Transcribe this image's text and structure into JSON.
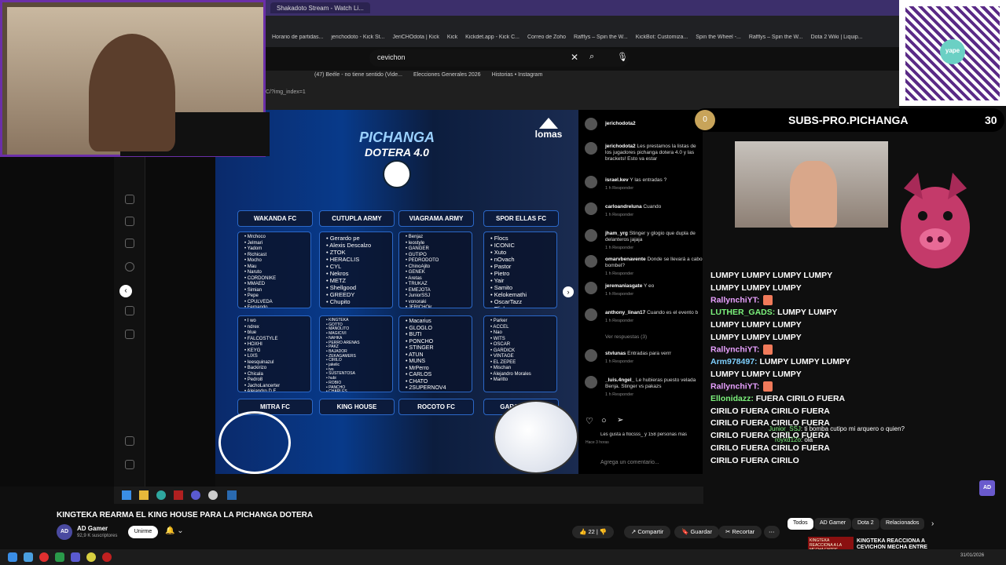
{
  "browser": {
    "tabs": [
      "Shakadoto Stream - Watch Li..."
    ],
    "bookmarks": [
      "Horario de partidas...",
      "jerichodoto - Kick St...",
      "JeriCHOdota | Kick",
      "Kick",
      "Kickdet.app - Kick C...",
      "Correo de Zoho",
      "Rafflys – Spin the W...",
      "KickBot: Customiza...",
      "Spin the Wheel -...",
      "Rafflys – Spin the W...",
      "Dota 2 Wiki | Liquip..."
    ],
    "search_value": "cevichon"
  },
  "inner_browser": {
    "tabs": [
      "(47) Beéle - no tiene sentido (Vide...",
      "Elecciones Generales 2026",
      "Historias • Instagram"
    ],
    "address": "C/?img_index=1"
  },
  "graphic": {
    "title1": "PICHANGA",
    "title2": "DOTERA",
    "version": "4.0",
    "sponsor": "lomas",
    "teams": [
      "WAKANDA FC",
      "CUTUPLA ARMY",
      "VIAGRAMA ARMY",
      "SPOR ELLAS FC",
      "MITRA FC",
      "KING HOUSE",
      "ROCOTO FC",
      "GARGOLA FC"
    ],
    "rosters": [
      [
        "Mrchoco",
        "Jelmari",
        "Yadom",
        "Richicast",
        "Mocho",
        "Mau",
        "Naruto",
        "CORDONIKE",
        "MMAED",
        "Simian",
        "Pepe",
        "CPULVEDA",
        "Fernando"
      ],
      [
        "Gerardo pe",
        "Alexis Descalzo",
        "ZTOK",
        "HERACLIS",
        "CYL",
        "Nekros",
        "METZ",
        "Shellgood",
        "GREEDY",
        "Chupito"
      ],
      [
        "Benjaz",
        "leostyle",
        "GANGER",
        "GUTIPO",
        "PEDRODOTO",
        "ChinoAjito",
        "GENEK",
        "Aretas",
        "TRUKAZ",
        "EMEJOTA",
        "JuniorSSJ",
        "vonoraki",
        "JERICHOjr"
      ],
      [
        "Flocs",
        "ICONIC",
        "Xuto",
        "nOvach",
        "Pastor",
        "Pietro",
        "Yair",
        "Samito",
        "Kelokemathi",
        "OscarTazz",
        "Flick"
      ],
      [
        "I wo",
        "ndrex",
        "blue",
        "FALCOSTYLE",
        "HOXHI",
        "KEYG",
        "LIXS",
        "Ieesquinazul",
        "Backirizo",
        "Chicala",
        "Pedro8",
        "JachoLancerter",
        "Alejandro D.F."
      ],
      [
        "KINGTEKA",
        "GOTTO",
        "MANOLITO",
        "MAGICIVI",
        "NAHKA",
        "PERRO ARENAS",
        "PAKZ",
        "BAJADOR",
        "ZEKAGAMERS",
        "CIRILO",
        "jakelic",
        "tvs",
        "SUSTENTOSA",
        "hubi",
        "ROBIO",
        "PANCHO",
        "CHARLES"
      ],
      [
        "Macarius",
        "GLOGLO",
        "BUTI",
        "PONCHO",
        "STINGER",
        "ATUN",
        "MUNS",
        "MrPerro",
        "CARLOS",
        "CHATO",
        "2SUPERNOV4"
      ],
      [
        "Parker",
        "ACCEL",
        "Nao",
        "WITS",
        "OSCAR",
        "GARDICK",
        "VINTAGE",
        "EL ZEPEE",
        "Mischan",
        "Alejandro Morales",
        "Maritto"
      ]
    ]
  },
  "instagram": {
    "author": "jerichodota2",
    "caption": "Les prestamos la listas de los jugadores pichanga dotera 4.0 y las brackets! Esto va estar",
    "comments": [
      {
        "user": "israel.kev",
        "text": "Y las entradas ?",
        "meta": "1 h   Responder"
      },
      {
        "user": "carloandreluna",
        "text": "Cuando",
        "meta": "1 h   Responder"
      },
      {
        "user": "jham_yrg",
        "text": "Stinger y glogio que dupla de delanteros jajaja",
        "meta": "1 h   Responder"
      },
      {
        "user": "omarvbenavente",
        "text": "Donde se llevará a cabo bombel?",
        "meta": "1 h   Responder"
      },
      {
        "user": "jeremaniasgate",
        "text": "Y eo",
        "meta": "1 h   Responder"
      },
      {
        "user": "anthony_linan17",
        "text": "Cuando es el evento b",
        "meta": "1 h   Responder"
      },
      {
        "user": "",
        "text": "Ver respuestas (3)",
        "meta": ""
      },
      {
        "user": "stvlunas",
        "text": "Entradas para verrr",
        "meta": "1 h   Responder"
      },
      {
        "user": "_luis.4ngel_",
        "text": "Le hubieras puesto velada Benja. Stinger vs pakazs",
        "meta": "1 h   Responder"
      }
    ],
    "likes": "Les gusta a flocsss_ y 158 personas más",
    "likes_time": "Hace 3 horas",
    "comment_placeholder": "Agrega un comentario..."
  },
  "overlay": {
    "qr_label": "yape",
    "subs_count_left": "0",
    "subs_label": "SUBS-PRO.PICHANGA",
    "subs_count_right": "30"
  },
  "chat": [
    {
      "user": "",
      "text": "LUMPY  LUMPY LUMPY  LUMPY"
    },
    {
      "user": "",
      "text": "LUMPY  LUMPY LUMPY"
    },
    {
      "user": "RallynchiYT:",
      "text": ""
    },
    {
      "user": "LUTHER_GADS:",
      "text": "LUMPY  LUMPY"
    },
    {
      "user": "",
      "text": "LUMPY  LUMPY  LUMPY"
    },
    {
      "user": "",
      "text": "LUMPY  LUMPY  LUMPY"
    },
    {
      "user": "RallynchiYT:",
      "text": ""
    },
    {
      "user": "Arm978497:",
      "text": "LUMPY LUMPY  LUMPY"
    },
    {
      "user": "",
      "text": "LUMPY  LUMPY LUMPY"
    },
    {
      "user": "RallynchiYT:",
      "text": ""
    },
    {
      "user": "Ellonidazz:",
      "text": "FUERA CIRILO  FUERA"
    },
    {
      "user": "",
      "text": "CIRILO  FUERA CIRILO  FUERA"
    },
    {
      "user": "",
      "text": "CIRILO  FUERA CIRILO  FUERA"
    },
    {
      "user": "",
      "text": "CIRILO  FUERA CIRILO  FUERA"
    },
    {
      "user": "",
      "text": "CIRILO  FUERA CIRILO  FUERA"
    },
    {
      "user": "",
      "text": "CIRILO  FUERA CIRILO"
    }
  ],
  "chat_inline": [
    {
      "user": "Junior_SSJ",
      "text": ": ti bomba cutipo mi arquero o quien?"
    },
    {
      "user": "royxd12o",
      "text": ": ola"
    }
  ],
  "video": {
    "title": "KINGTEKA REARMA EL KING HOUSE PARA LA PICHANGA DOTERA",
    "channel": "AD Gamer",
    "subscribers": "92,9 K suscriptores",
    "join_label": "Unirme",
    "likes": "22",
    "share_label": "Compartir",
    "save_label": "Guardar",
    "clip_label": "Recortar",
    "chips": [
      "Todos",
      "AD Gamer",
      "Dota 2",
      "Relacionados"
    ],
    "rec_title": "KINGTEKA REACCIONA A CEVICHON MECHA ENTRE",
    "rec_thumb_text": "KINGTEKA REACCIONA A LA MECHA ENTRE MATTHEW Y POLI"
  },
  "os": {
    "date": "31/01/2026"
  },
  "colors": {
    "webcam_border": "#6b2fa8",
    "team_border": "#2b68c8",
    "lumpy_green": "#3ad38a",
    "chat_red": "#e21a3a"
  }
}
